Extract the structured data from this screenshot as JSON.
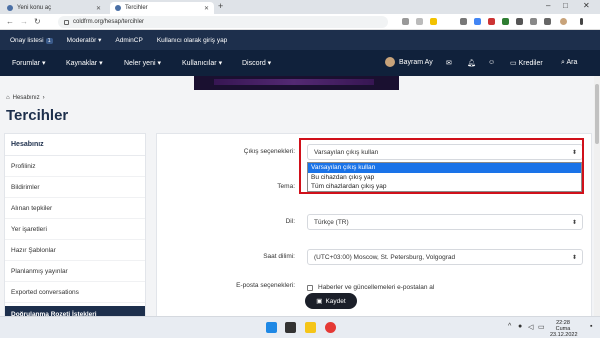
{
  "browser": {
    "tabs": [
      {
        "label": "Yeni konu aç"
      },
      {
        "label": "Tercihler"
      }
    ],
    "new_tab": "+",
    "url": "coldfrm.org/hesap/tercihler",
    "window_controls": [
      "‒",
      "□",
      "✕"
    ]
  },
  "admin_bar": {
    "items": [
      {
        "label": "Onay listesi",
        "badge": "1"
      },
      {
        "label": "Moderatör ▾"
      },
      {
        "label": "AdminCP"
      },
      {
        "label": "Kullanıcı olarak giriş yap"
      }
    ]
  },
  "main_nav": {
    "items": [
      "Forumlar ▾",
      "Kaynaklar ▾",
      "Neler yeni ▾",
      "Kullanıcılar ▾",
      "Discord ▾"
    ],
    "user_name": "Bayram Ay",
    "credits_label": "Krediler",
    "search_label": "Ara"
  },
  "breadcrumb": {
    "label": "Hesabınız",
    "sep": "›"
  },
  "page_title": "Tercihler",
  "sidebar": {
    "heading": "Hesabınız",
    "items": [
      "Profiliniz",
      "Bildirimler",
      "Alınan tepkiler",
      "Yer işaretleri",
      "Hazır Şablonlar",
      "Planlanmış yayınlar",
      "Exported conversations"
    ],
    "footer_item": "Doğrulanma Rozeti İstekleri"
  },
  "form": {
    "style_label": "Çıkış seçenekleri:",
    "style_value": "Varsayılan çıkış kullan",
    "style_options": [
      "Varsayılan çıkış kullan",
      "Bu cihazdan çıkış yap",
      "Tüm cihazlardan çıkış yap"
    ],
    "theme_label": "Tema:",
    "language_label": "Dil:",
    "language_value": "Türkçe (TR)",
    "timezone_label": "Saat dilimi:",
    "timezone_value": "(UTC+03:00) Moscow, St. Petersburg, Volgograd",
    "email_label": "E-posta seçenekleri:",
    "email_checkbox": "Haberler ve güncellemeleri e-postalan al",
    "save_label": "Kaydet"
  },
  "taskbar": {
    "time": "22:28",
    "day": "Cuma",
    "date": "23.12.2022"
  },
  "colors": {
    "admin_bar": "#1d2f4c",
    "main_nav": "#10213b",
    "highlight_box": "#d0101a",
    "selected_option": "#1a73e8"
  }
}
